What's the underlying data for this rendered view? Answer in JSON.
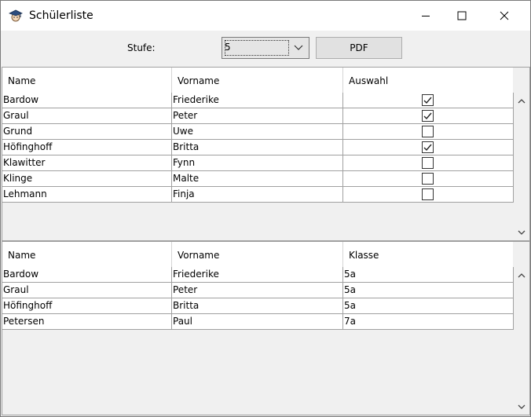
{
  "window": {
    "title": "Schülerliste"
  },
  "toolbar": {
    "stufe_label": "Stufe:",
    "stufe_value": "5",
    "pdf_label": "PDF"
  },
  "top_table": {
    "headers": [
      "Name",
      "Vorname",
      "Auswahl"
    ],
    "rows": [
      {
        "name": "Bardow",
        "vorname": "Friederike",
        "checked": true
      },
      {
        "name": "Graul",
        "vorname": "Peter",
        "checked": true
      },
      {
        "name": "Grund",
        "vorname": "Uwe",
        "checked": false
      },
      {
        "name": "Höfinghoff",
        "vorname": "Britta",
        "checked": true
      },
      {
        "name": "Klawitter",
        "vorname": "Fynn",
        "checked": false
      },
      {
        "name": "Klinge",
        "vorname": "Malte",
        "checked": false
      },
      {
        "name": "Lehmann",
        "vorname": "Finja",
        "checked": false
      }
    ]
  },
  "bottom_table": {
    "headers": [
      "Name",
      "Vorname",
      "Klasse"
    ],
    "rows": [
      {
        "name": "Bardow",
        "vorname": "Friederike",
        "klasse": "5a"
      },
      {
        "name": "Graul",
        "vorname": "Peter",
        "klasse": "5a"
      },
      {
        "name": "Höfinghoff",
        "vorname": "Britta",
        "klasse": "5a"
      },
      {
        "name": "Petersen",
        "vorname": "Paul",
        "klasse": "7a"
      }
    ]
  },
  "icons": {
    "app": "student-cap-icon",
    "minimize": "minimize-icon",
    "maximize": "maximize-icon",
    "close": "close-icon",
    "dropdown": "chevron-down-icon",
    "scroll_up": "scroll-up-icon",
    "scroll_down": "scroll-down-icon",
    "check": "checkmark-icon"
  }
}
